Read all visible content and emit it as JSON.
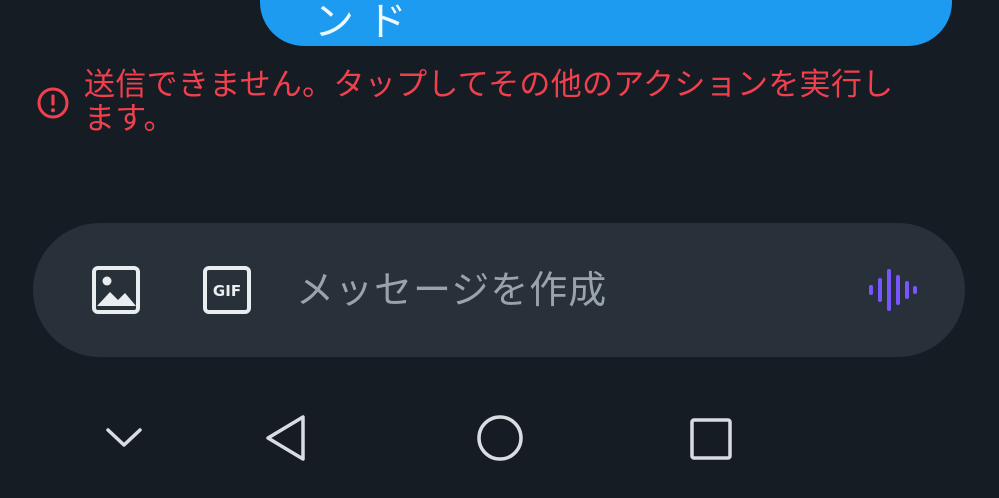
{
  "message": {
    "text_partial": "ン ド"
  },
  "error": {
    "text": "送信できません。タップしてその他のアクションを実行します。",
    "color": "#f0404e",
    "icon": "alert-circle-icon"
  },
  "composer": {
    "placeholder": "メッセージを作成",
    "image_icon": "image-icon",
    "gif_icon": "gif-icon",
    "gif_label": "GIF",
    "voice_icon": "voice-waveform-icon",
    "voice_color": "#7856ff"
  },
  "nav_bar": {
    "collapse_icon": "chevron-down-icon",
    "back_icon": "back-triangle-icon",
    "home_icon": "home-circle-icon",
    "recents_icon": "recents-square-icon"
  }
}
